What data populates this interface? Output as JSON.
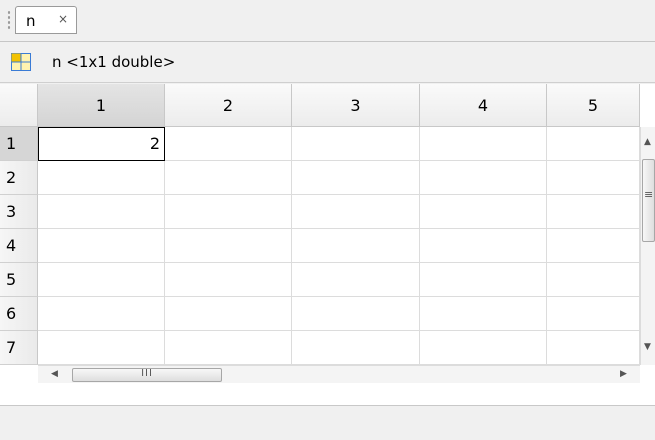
{
  "tab": {
    "label": "n",
    "close_glyph": "×"
  },
  "variable_bar": {
    "label": "n <1x1 double>",
    "icon": "table-grid-icon",
    "icon_color": "#e6b800"
  },
  "grid": {
    "columns": [
      "1",
      "2",
      "3",
      "4",
      "5"
    ],
    "rows": [
      "1",
      "2",
      "3",
      "4",
      "5",
      "6",
      "7"
    ],
    "cells": [
      [
        "2",
        "",
        "",
        "",
        ""
      ]
    ],
    "selected_cell": {
      "row": 1,
      "column": 1
    }
  },
  "scrollbars": {
    "vertical_grip": "≡",
    "horizontal_grip": "III"
  }
}
